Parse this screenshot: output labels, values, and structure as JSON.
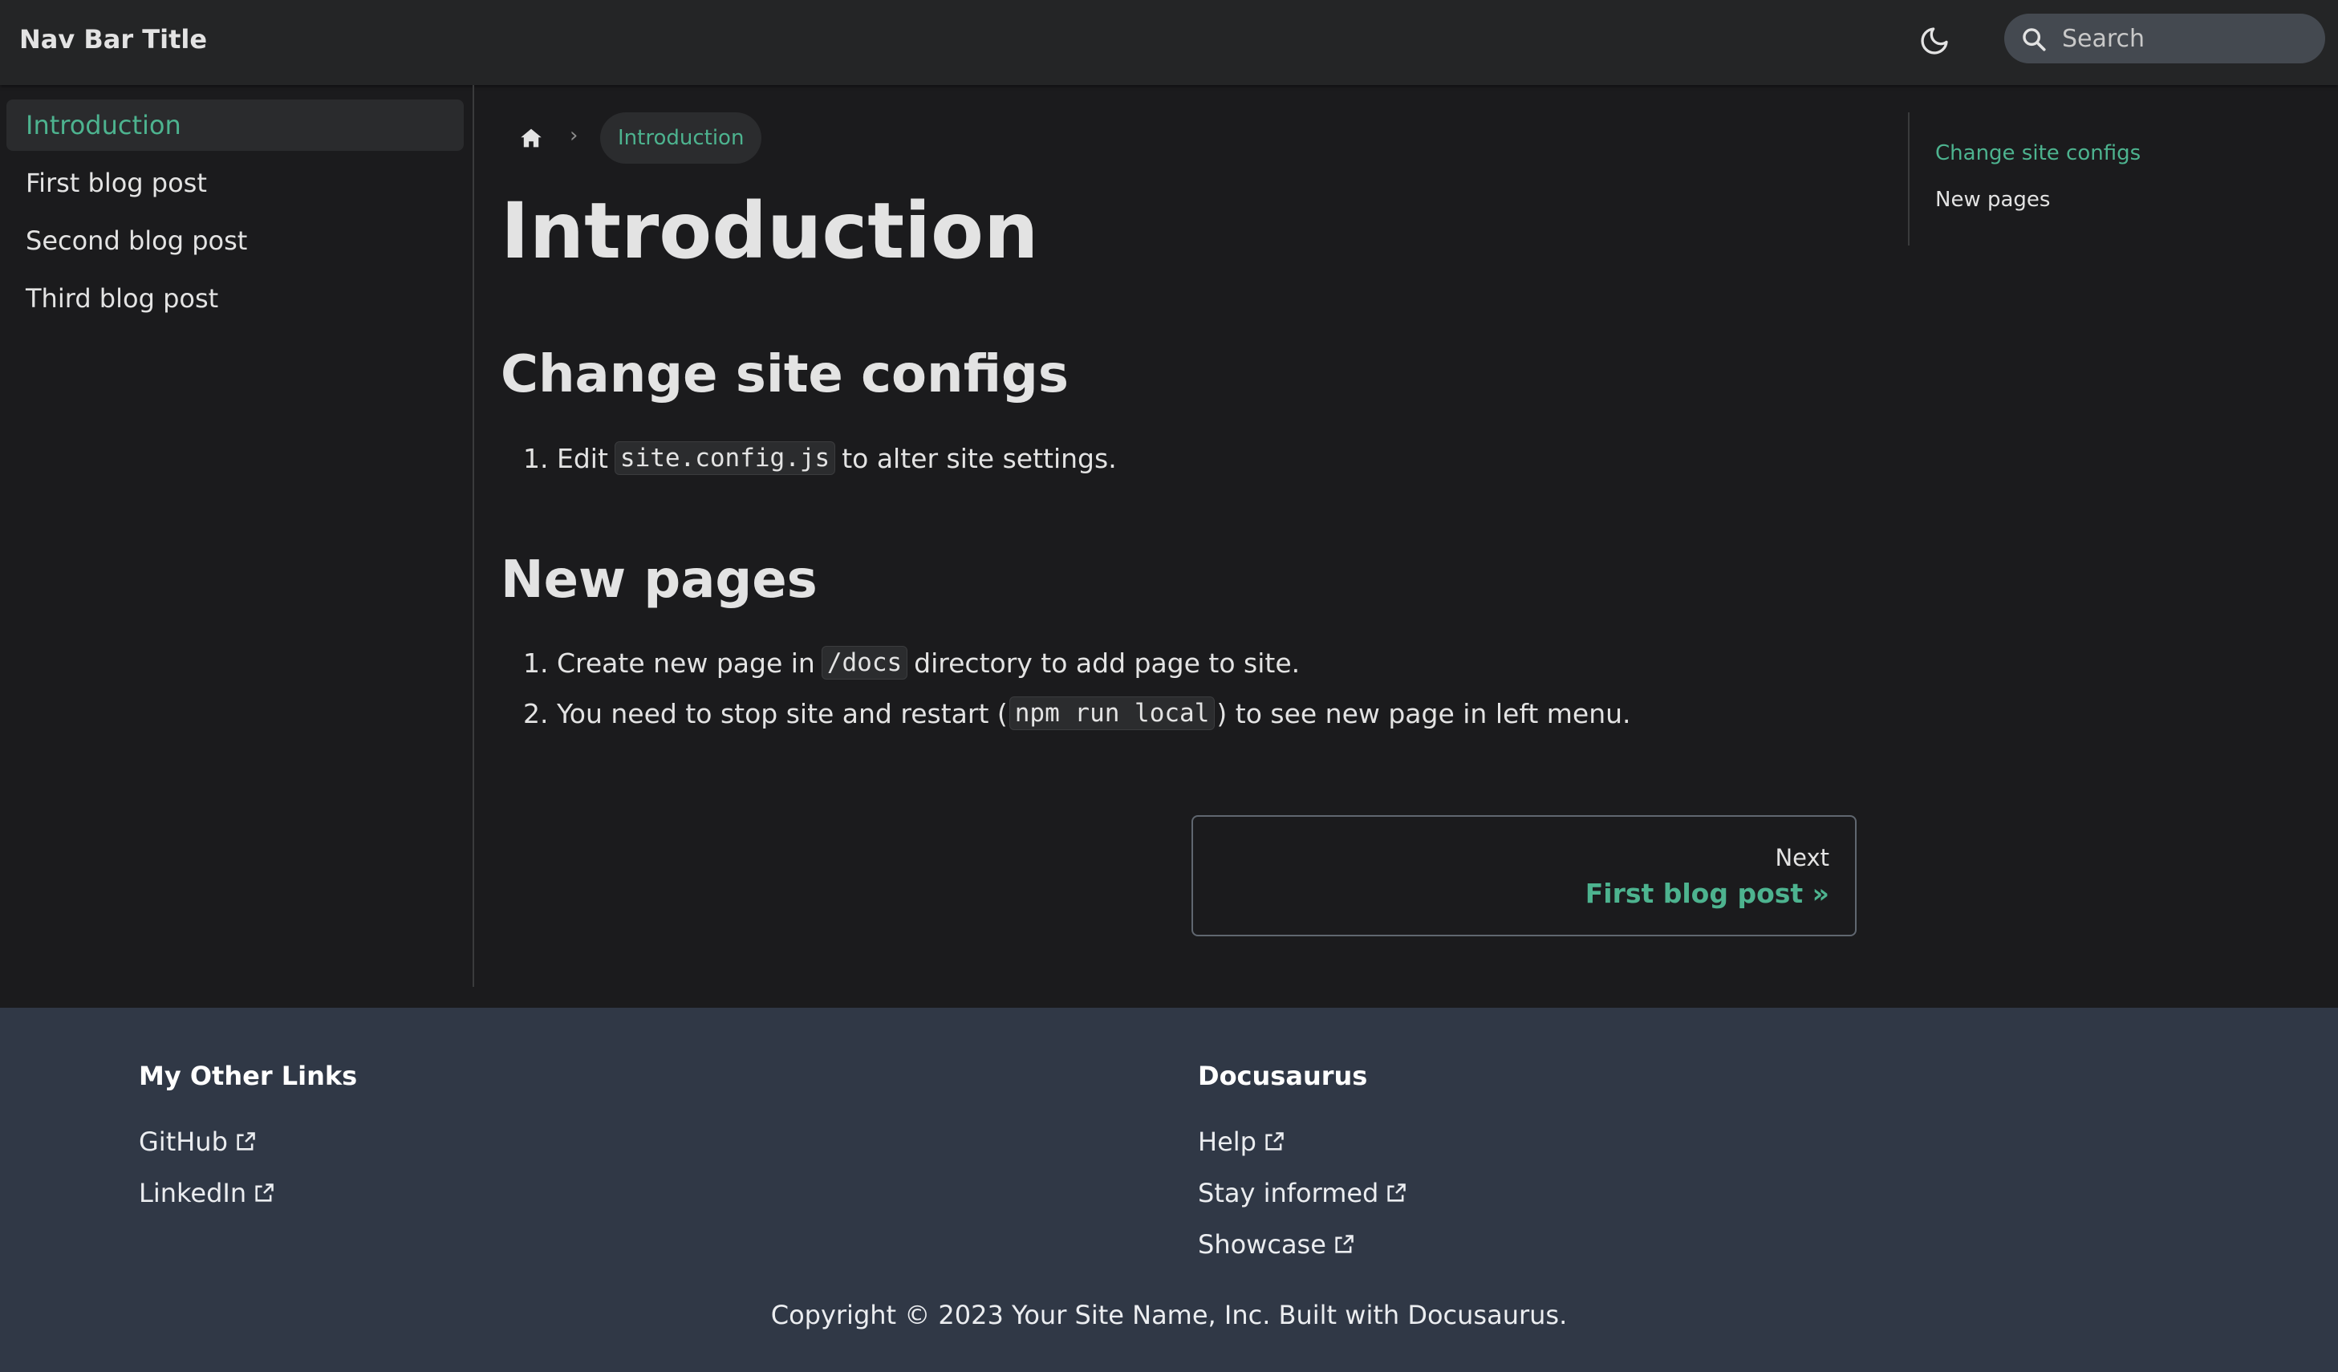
{
  "navbar": {
    "title": "Nav Bar Title",
    "theme_icon": "moon-icon",
    "search_placeholder": "Search"
  },
  "sidebar": {
    "items": [
      {
        "label": "Introduction",
        "active": true
      },
      {
        "label": "First blog post",
        "active": false
      },
      {
        "label": "Second blog post",
        "active": false
      },
      {
        "label": "Third blog post",
        "active": false
      }
    ]
  },
  "breadcrumbs": {
    "home_icon": "home-icon",
    "current": "Introduction"
  },
  "content": {
    "title": "Introduction",
    "sections": [
      {
        "heading": "Change site configs",
        "items": [
          {
            "number": "1.",
            "before": "Edit",
            "code": "site.config.js",
            "after": "to alter site settings."
          }
        ]
      },
      {
        "heading": "New pages",
        "items": [
          {
            "number": "1.",
            "before": "Create new page in",
            "code": "/docs",
            "after": "directory to add page to site."
          },
          {
            "number": "2.",
            "before": "You need to stop site and restart (",
            "code": "npm run local",
            "after": ") to see new page in left menu."
          }
        ]
      }
    ],
    "pager": {
      "sublabel": "Next",
      "label": "First blog post »"
    }
  },
  "toc": {
    "items": [
      {
        "label": "Change site configs",
        "active": true
      },
      {
        "label": "New pages",
        "active": false
      }
    ]
  },
  "footer": {
    "columns": [
      {
        "title": "My Other Links",
        "links": [
          "GitHub",
          "LinkedIn"
        ]
      },
      {
        "title": "Docusaurus",
        "links": [
          "Help",
          "Stay informed",
          "Showcase"
        ]
      }
    ],
    "copyright": "Copyright © 2023 Your Site Name, Inc. Built with Docusaurus."
  },
  "colors": {
    "accent": "#4db38f",
    "background": "#1b1b1d",
    "navbar": "#242526",
    "footer": "#303846"
  }
}
